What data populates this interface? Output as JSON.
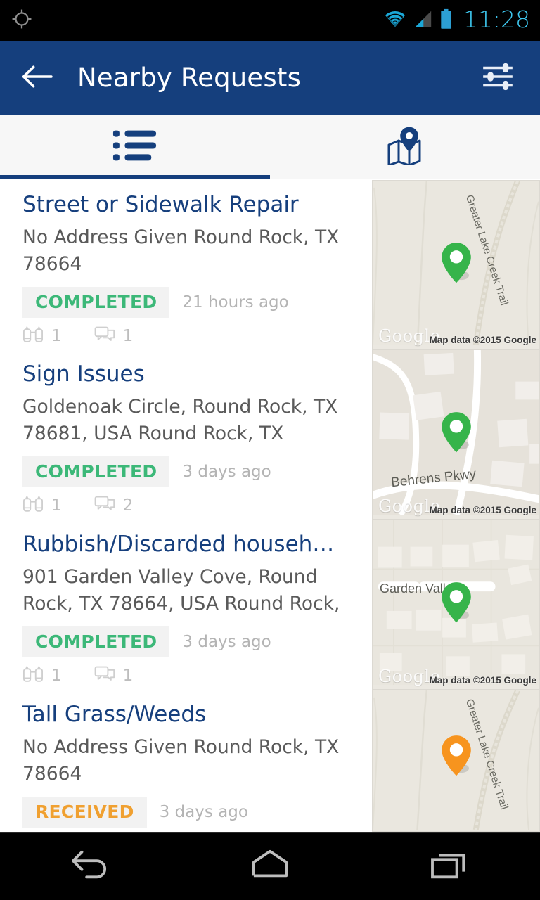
{
  "statusbar": {
    "gps_icon": "gps-crosshair-icon",
    "wifi_icon": "wifi-icon",
    "signal_icon": "cell-signal-icon",
    "battery_icon": "battery-full-icon",
    "clock": "11:28",
    "clock_color": "#3ec8f0"
  },
  "appbar": {
    "back_icon": "back-arrow-icon",
    "title": "Nearby Requests",
    "filter_icon": "filter-sliders-icon",
    "background": "#153f7d"
  },
  "tabs": {
    "active_index": 0,
    "indicator_color": "#153f7d",
    "items": [
      {
        "icon": "list-view-icon",
        "name": "tab-list-view"
      },
      {
        "icon": "map-view-icon",
        "name": "tab-map-view"
      }
    ]
  },
  "requests": [
    {
      "title": "Street or Sidewalk Repair",
      "address": "No Address Given Round Rock, TX 78664",
      "status": "COMPLETED",
      "status_type": "completed",
      "status_color": "#3cb878",
      "time_ago": "21 hours ago",
      "watchers": "1",
      "comments": "1",
      "map": {
        "pin_color": "#36b44a",
        "street_label": "Greater Lake Creek Trail",
        "watermark": "Google",
        "attribution": "Map data ©2015 Google"
      }
    },
    {
      "title": "Sign Issues",
      "address": "Goldenoak Circle, Round Rock, TX 78681, USA Round Rock, TX",
      "status": "COMPLETED",
      "status_type": "completed",
      "status_color": "#3cb878",
      "time_ago": "3 days ago",
      "watchers": "1",
      "comments": "2",
      "map": {
        "pin_color": "#36b44a",
        "street_label": "Behrens Pkwy",
        "watermark": "Google",
        "attribution": "Map data ©2015 Google"
      }
    },
    {
      "title": "Rubbish/Discarded househ…",
      "address": "901 Garden Valley Cove, Round Rock, TX 78664, USA Round Rock,",
      "status": "COMPLETED",
      "status_type": "completed",
      "status_color": "#3cb878",
      "time_ago": "3 days ago",
      "watchers": "1",
      "comments": "1",
      "map": {
        "pin_color": "#36b44a",
        "street_label": "Garden Valley",
        "watermark": "Google",
        "attribution": "Map data ©2015 Google"
      }
    },
    {
      "title": "Tall Grass/Weeds",
      "address": "No Address Given Round Rock, TX 78664",
      "status": "RECEIVED",
      "status_type": "received",
      "status_color": "#f0a030",
      "time_ago": "3 days ago",
      "watchers": "",
      "comments": "",
      "map": {
        "pin_color": "#f7941e",
        "street_label": "Greater Lake Creek Trail",
        "watermark": "",
        "attribution": ""
      }
    }
  ],
  "navbar": {
    "back_icon": "nav-back-icon",
    "home_icon": "nav-home-icon",
    "recents_icon": "nav-recents-icon"
  }
}
